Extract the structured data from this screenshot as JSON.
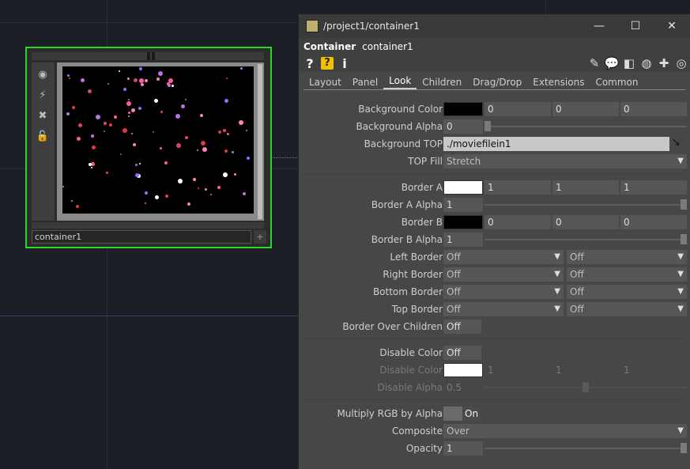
{
  "node": {
    "label": "container1",
    "side_icons": [
      "viewer-icon",
      "pulse-icon",
      "close-icon",
      "lock-icon"
    ],
    "plus_label": "+"
  },
  "panel": {
    "title": "/project1/container1",
    "window_controls": [
      "—",
      "☐",
      "✕"
    ],
    "op_type": "Container",
    "op_name": "container1",
    "left_icons": [
      "?",
      "?",
      "i"
    ],
    "tabs": [
      "Layout",
      "Panel",
      "Look",
      "Children",
      "Drag/Drop",
      "Extensions",
      "Common"
    ],
    "active_tab": "Look",
    "colors": {
      "green_select": "#29d629",
      "panel_bg": "#474747"
    }
  },
  "params": {
    "bg_color": {
      "label": "Background Color",
      "swatch": "#000000",
      "v": [
        "0",
        "0",
        "0"
      ]
    },
    "bg_alpha": {
      "label": "Background Alpha",
      "value": "0",
      "level": 0
    },
    "bg_top": {
      "label": "Background TOP",
      "value": "./moviefilein1"
    },
    "top_fill": {
      "label": "TOP Fill",
      "value": "Stretch"
    },
    "border_a": {
      "label": "Border A",
      "swatch": "#ffffff",
      "v": [
        "1",
        "1",
        "1"
      ]
    },
    "border_a_alpha": {
      "label": "Border A Alpha",
      "value": "1",
      "level": 1
    },
    "border_b": {
      "label": "Border B",
      "swatch": "#000000",
      "v": [
        "0",
        "0",
        "0"
      ]
    },
    "border_b_alpha": {
      "label": "Border B Alpha",
      "value": "1",
      "level": 1
    },
    "left_border": {
      "label": "Left Border",
      "a": "Off",
      "b": "Off"
    },
    "right_border": {
      "label": "Right Border",
      "a": "Off",
      "b": "Off"
    },
    "bottom_border": {
      "label": "Bottom Border",
      "a": "Off",
      "b": "Off"
    },
    "top_border": {
      "label": "Top Border",
      "a": "Off",
      "b": "Off"
    },
    "border_over_children": {
      "label": "Border Over Children",
      "value": "Off"
    },
    "disable_color_toggle": {
      "label": "Disable Color",
      "value": "Off"
    },
    "disable_color": {
      "label": "Disable Color",
      "swatch": "#ffffff",
      "v": [
        "1",
        "1",
        "1"
      ]
    },
    "disable_alpha": {
      "label": "Disable Alpha",
      "value": "0.5",
      "level": 0.5
    },
    "multiply_rgb": {
      "label": "Multiply RGB by Alpha",
      "value": "On"
    },
    "composite": {
      "label": "Composite",
      "value": "Over"
    },
    "opacity": {
      "label": "Opacity",
      "value": "1",
      "level": 1
    }
  }
}
